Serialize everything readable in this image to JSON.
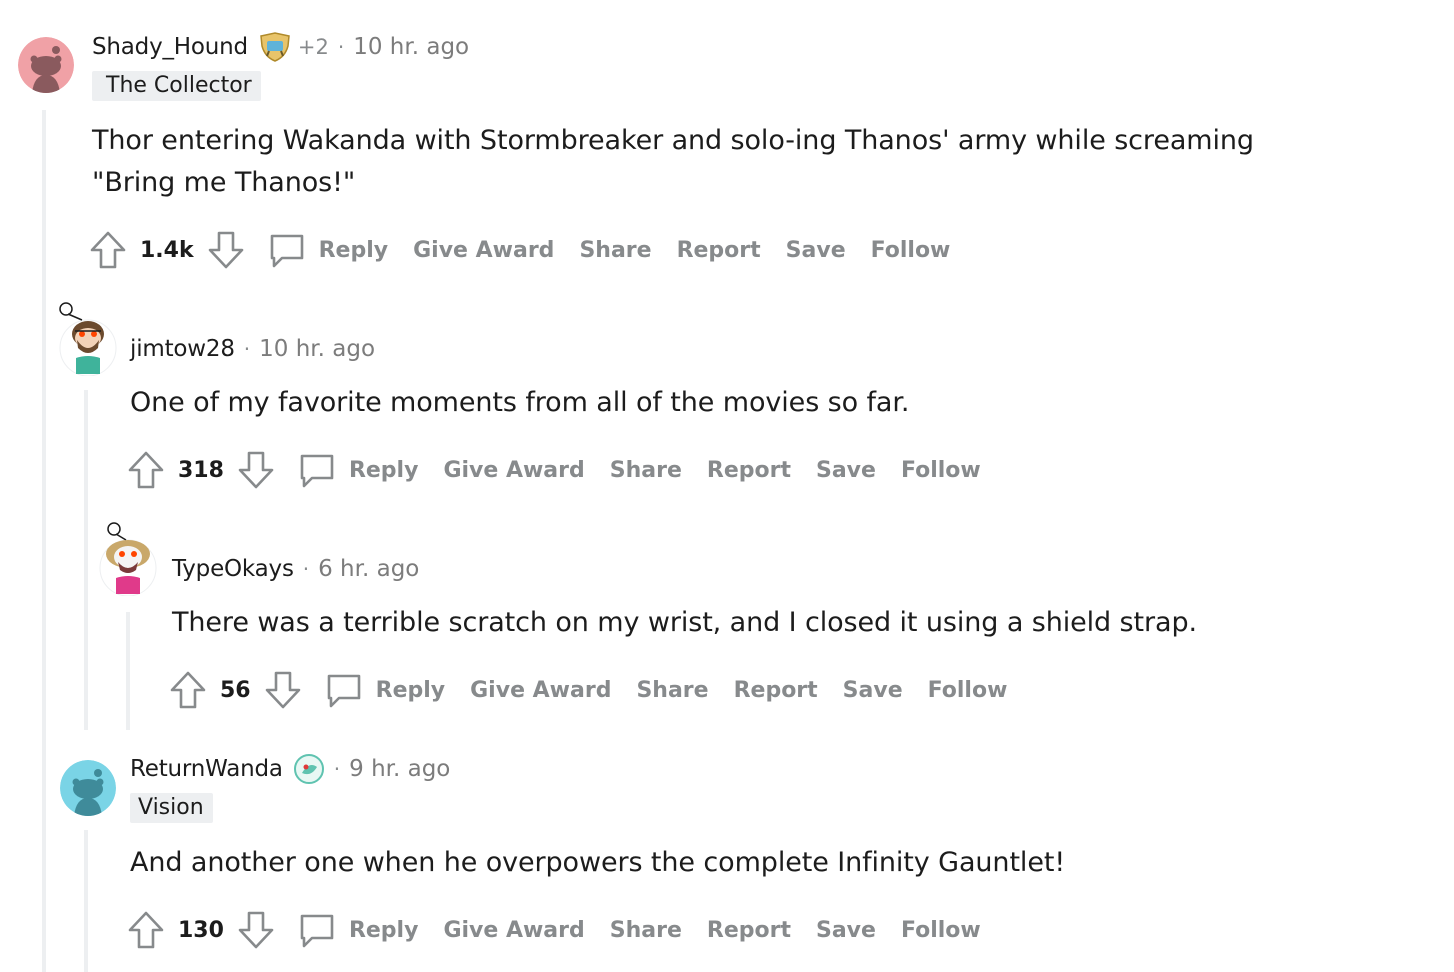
{
  "colors": {
    "upvote_stroke": "#878a8c",
    "thread_line": "#edeff1",
    "text": "#1c1c1c",
    "muted": "#878a8c"
  },
  "actions": {
    "reply": "Reply",
    "give_award": "Give Award",
    "share": "Share",
    "report": "Report",
    "save": "Save",
    "follow": "Follow"
  },
  "comments": [
    {
      "username": "Shady_Hound",
      "award_icon": "achievement-badge-icon",
      "extra": "+2",
      "time": "10 hr. ago",
      "flair": "The Collector",
      "body": "Thor entering Wakanda with Stormbreaker and solo-ing Thanos' army while screaming \"Bring me Thanos!\"",
      "score": "1.4k",
      "avatar_icon": "default-snoo-avatar-icon",
      "avatar_color": "#f0a1a6"
    },
    {
      "username": "jimtow28",
      "time": "10 hr. ago",
      "body": "One of my favorite moments from all of the movies so far.",
      "score": "318",
      "avatar_icon": "bearded-snoo-avatar-icon"
    },
    {
      "username": "TypeOkays",
      "time": "6 hr. ago",
      "body": "There was a terrible scratch on my wrist, and I closed it using a shield strap.",
      "score": "56",
      "avatar_icon": "pink-snoo-avatar-icon"
    },
    {
      "username": "ReturnWanda",
      "flair_icon": "vision-flair-icon",
      "time": "9 hr. ago",
      "flair": "Vision",
      "body": "And another one when he overpowers the complete Infinity Gauntlet!",
      "score": "130",
      "avatar_icon": "default-snoo-avatar-icon",
      "avatar_color": "#7ad4e6"
    }
  ],
  "separator": "·"
}
